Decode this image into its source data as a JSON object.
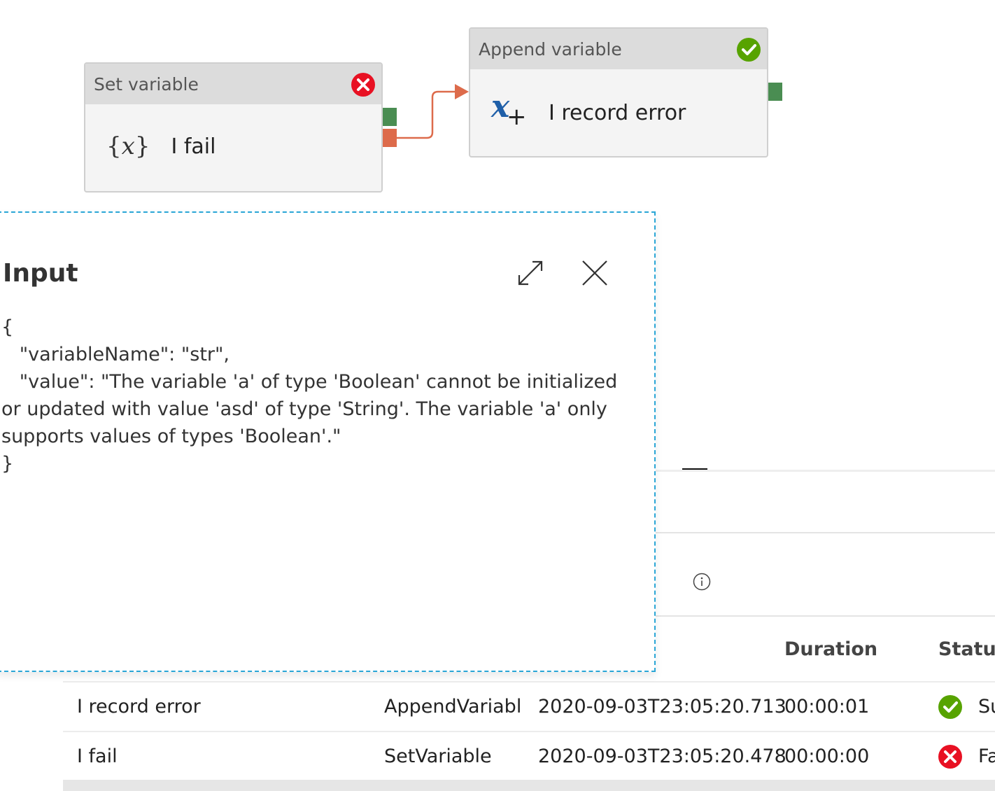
{
  "pipeline": {
    "set_variable": {
      "type": "Set variable",
      "name": "I fail",
      "status": "failed",
      "icon": "variable-braces-icon"
    },
    "append_variable": {
      "type": "Append variable",
      "name": "I record error",
      "status": "succeeded",
      "icon": "append-variable-icon"
    }
  },
  "input_panel": {
    "title": "Input",
    "content": "{\n   \"variableName\": \"str\",\n   \"value\": \"The variable 'a' of type 'Boolean' cannot be initialized or updated with value 'asd' of type 'String'. The variable 'a' only supports values of types 'Boolean'.\"\n}",
    "expand_icon": "expand-icon",
    "close_icon": "close-icon"
  },
  "table": {
    "headers": {
      "duration": "Duration",
      "status": "Status"
    },
    "rows": [
      {
        "name": "I record error",
        "type": "AppendVariabl",
        "start": "2020-09-03T23:05:20.713",
        "duration": "00:00:01",
        "status": "Su",
        "status_kind": "succeeded"
      },
      {
        "name": "I fail",
        "type": "SetVariable",
        "start": "2020-09-03T23:05:20.478",
        "duration": "00:00:00",
        "status": "Fa",
        "status_kind": "failed"
      }
    ]
  },
  "colors": {
    "success": "#57a300",
    "fail": "#e81123",
    "port_success": "#4a8d52",
    "port_fail": "#dd6b4b",
    "panel_border": "#2aa6d6"
  }
}
